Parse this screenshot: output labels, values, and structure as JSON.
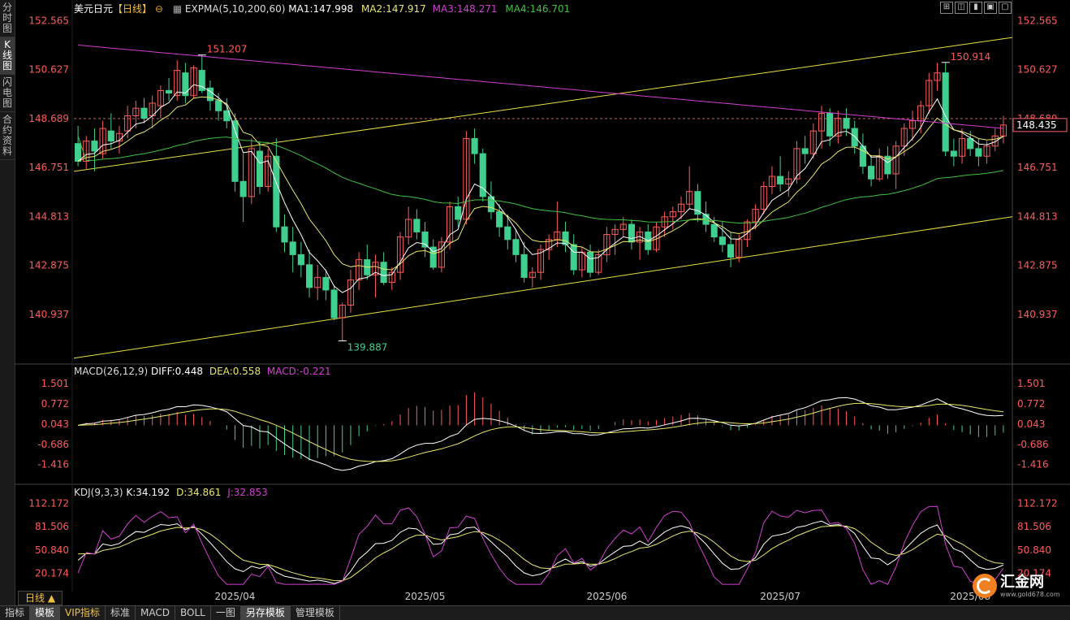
{
  "sidebar": {
    "tabs": [
      {
        "label": "分时图",
        "active": false
      },
      {
        "label": "K线图",
        "active": true
      },
      {
        "label": "闪电图",
        "active": false
      },
      {
        "label": "合约资料",
        "active": false
      }
    ]
  },
  "header": {
    "symbol": "美元日元",
    "period": "【日线】",
    "expma_label": "EXPMA(5,10,200,60)",
    "ma1": "MA1:147.998",
    "ma2": "MA2:147.917",
    "ma3": "MA3:148.271",
    "ma4": "MA4:146.701"
  },
  "window_buttons": [
    "⊞",
    "◫",
    "▮",
    "▣",
    "▢"
  ],
  "price_axis": {
    "ticks": [
      "152.565",
      "150.627",
      "148.689",
      "146.751",
      "144.813",
      "142.875",
      "140.937"
    ],
    "current_price": "148.435",
    "ref_price": "148.689"
  },
  "annotations": {
    "high1": "151.207",
    "low1": "139.887",
    "high2": "150.914"
  },
  "macd": {
    "label": "MACD(26,12,9)",
    "diff": "DIFF:0.448",
    "dea": "DEA:0.558",
    "macd": "MACD:-0.221",
    "ticks": [
      "1.501",
      "0.772",
      "0.043",
      "-0.686",
      "-1.416"
    ]
  },
  "kdj": {
    "label": "KDJ(9,3,3)",
    "k": "K:34.192",
    "d": "D:34.861",
    "j": "J:32.853",
    "ticks": [
      "112.172",
      "81.506",
      "50.840",
      "20.174"
    ]
  },
  "time_axis": [
    "2025/04",
    "2025/05",
    "2025/06",
    "2025/07",
    "2025/08"
  ],
  "period_button": "日线 ▲",
  "bottom_tabs": [
    {
      "label": "指标",
      "active": false,
      "vip": false
    },
    {
      "label": "模板",
      "active": true,
      "vip": false
    },
    {
      "label": "VIP指标",
      "active": false,
      "vip": true
    },
    {
      "label": "标准",
      "active": false,
      "vip": false
    },
    {
      "label": "MACD",
      "active": false,
      "vip": false
    },
    {
      "label": "BOLL",
      "active": false,
      "vip": false
    },
    {
      "label": "一图",
      "active": false,
      "vip": false
    },
    {
      "label": "另存模板",
      "active": true,
      "vip": false
    },
    {
      "label": "管理模板",
      "active": false,
      "vip": false
    }
  ],
  "logo": {
    "name": "汇金网",
    "url": "www.gold678.com"
  },
  "colors": {
    "up": "#ff5a5a",
    "down": "#3fcf8e",
    "ma1": "#ffffff",
    "ma2": "#e8e86a",
    "ma3": "#d040d0",
    "ma4": "#40c040",
    "channel": "#e8e040",
    "axis_text": "#ff5a5a"
  },
  "chart_data": {
    "type": "candlestick",
    "instrument": "USD/JPY",
    "period": "daily",
    "y_range": [
      139.0,
      153.0
    ],
    "points": [
      {
        "o": 147.7,
        "h": 148.4,
        "l": 146.8,
        "c": 147.0
      },
      {
        "o": 147.0,
        "h": 148.0,
        "l": 146.7,
        "c": 147.8
      },
      {
        "o": 147.8,
        "h": 148.3,
        "l": 146.6,
        "c": 147.4
      },
      {
        "o": 147.3,
        "h": 148.6,
        "l": 147.1,
        "c": 148.3
      },
      {
        "o": 148.2,
        "h": 148.9,
        "l": 147.5,
        "c": 147.8
      },
      {
        "o": 147.8,
        "h": 148.4,
        "l": 147.3,
        "c": 148.1
      },
      {
        "o": 148.2,
        "h": 149.2,
        "l": 147.9,
        "c": 148.8
      },
      {
        "o": 148.8,
        "h": 149.4,
        "l": 148.3,
        "c": 149.1
      },
      {
        "o": 149.1,
        "h": 149.5,
        "l": 148.5,
        "c": 148.7
      },
      {
        "o": 148.8,
        "h": 149.6,
        "l": 148.3,
        "c": 149.3
      },
      {
        "o": 149.2,
        "h": 150.0,
        "l": 148.7,
        "c": 149.8
      },
      {
        "o": 149.8,
        "h": 150.3,
        "l": 149.4,
        "c": 149.7
      },
      {
        "o": 149.6,
        "h": 151.0,
        "l": 149.4,
        "c": 150.6
      },
      {
        "o": 150.5,
        "h": 150.9,
        "l": 149.3,
        "c": 149.6
      },
      {
        "o": 149.6,
        "h": 150.8,
        "l": 149.5,
        "c": 150.7
      },
      {
        "o": 150.6,
        "h": 151.2,
        "l": 149.7,
        "c": 149.8
      },
      {
        "o": 149.9,
        "h": 150.2,
        "l": 149.0,
        "c": 149.4
      },
      {
        "o": 149.4,
        "h": 149.7,
        "l": 148.6,
        "c": 149.0
      },
      {
        "o": 149.0,
        "h": 149.5,
        "l": 148.3,
        "c": 148.6
      },
      {
        "o": 148.6,
        "h": 148.9,
        "l": 145.8,
        "c": 146.2
      },
      {
        "o": 146.2,
        "h": 147.3,
        "l": 144.6,
        "c": 145.6
      },
      {
        "o": 145.6,
        "h": 147.9,
        "l": 145.3,
        "c": 147.5
      },
      {
        "o": 147.4,
        "h": 147.8,
        "l": 145.7,
        "c": 146.0
      },
      {
        "o": 146.0,
        "h": 147.5,
        "l": 145.8,
        "c": 147.2
      },
      {
        "o": 147.2,
        "h": 147.9,
        "l": 144.2,
        "c": 144.4
      },
      {
        "o": 144.4,
        "h": 144.9,
        "l": 143.4,
        "c": 143.8
      },
      {
        "o": 143.8,
        "h": 144.4,
        "l": 142.6,
        "c": 143.3
      },
      {
        "o": 143.3,
        "h": 143.8,
        "l": 142.4,
        "c": 142.9
      },
      {
        "o": 142.9,
        "h": 143.5,
        "l": 141.6,
        "c": 142.0
      },
      {
        "o": 142.0,
        "h": 142.9,
        "l": 141.5,
        "c": 142.4
      },
      {
        "o": 142.4,
        "h": 142.7,
        "l": 141.5,
        "c": 141.9
      },
      {
        "o": 141.9,
        "h": 142.1,
        "l": 140.7,
        "c": 140.8
      },
      {
        "o": 140.8,
        "h": 141.4,
        "l": 139.9,
        "c": 141.3
      },
      {
        "o": 141.3,
        "h": 142.7,
        "l": 141.0,
        "c": 142.3
      },
      {
        "o": 142.3,
        "h": 143.4,
        "l": 141.9,
        "c": 143.1
      },
      {
        "o": 143.1,
        "h": 143.7,
        "l": 142.3,
        "c": 142.5
      },
      {
        "o": 142.5,
        "h": 143.3,
        "l": 141.6,
        "c": 143.0
      },
      {
        "o": 143.0,
        "h": 143.4,
        "l": 142.1,
        "c": 142.2
      },
      {
        "o": 142.2,
        "h": 142.8,
        "l": 141.9,
        "c": 142.6
      },
      {
        "o": 142.6,
        "h": 144.2,
        "l": 142.3,
        "c": 144.0
      },
      {
        "o": 144.0,
        "h": 145.2,
        "l": 143.7,
        "c": 144.7
      },
      {
        "o": 144.7,
        "h": 145.1,
        "l": 143.9,
        "c": 144.2
      },
      {
        "o": 144.2,
        "h": 144.6,
        "l": 143.2,
        "c": 143.6
      },
      {
        "o": 143.6,
        "h": 143.9,
        "l": 142.7,
        "c": 142.8
      },
      {
        "o": 142.8,
        "h": 144.0,
        "l": 142.6,
        "c": 143.8
      },
      {
        "o": 143.8,
        "h": 145.4,
        "l": 143.5,
        "c": 145.2
      },
      {
        "o": 145.2,
        "h": 145.6,
        "l": 144.4,
        "c": 144.7
      },
      {
        "o": 144.7,
        "h": 148.2,
        "l": 144.5,
        "c": 147.9
      },
      {
        "o": 147.9,
        "h": 148.3,
        "l": 146.9,
        "c": 147.3
      },
      {
        "o": 147.3,
        "h": 147.5,
        "l": 145.4,
        "c": 145.6
      },
      {
        "o": 145.6,
        "h": 146.2,
        "l": 144.7,
        "c": 145.0
      },
      {
        "o": 145.0,
        "h": 145.3,
        "l": 144.0,
        "c": 144.4
      },
      {
        "o": 144.4,
        "h": 144.9,
        "l": 143.5,
        "c": 143.9
      },
      {
        "o": 143.9,
        "h": 144.3,
        "l": 143.0,
        "c": 143.3
      },
      {
        "o": 143.3,
        "h": 143.8,
        "l": 142.2,
        "c": 142.4
      },
      {
        "o": 142.4,
        "h": 142.8,
        "l": 142.0,
        "c": 142.6
      },
      {
        "o": 142.6,
        "h": 143.7,
        "l": 142.3,
        "c": 143.5
      },
      {
        "o": 143.5,
        "h": 144.1,
        "l": 143.1,
        "c": 143.9
      },
      {
        "o": 143.9,
        "h": 145.4,
        "l": 143.6,
        "c": 144.2
      },
      {
        "o": 144.2,
        "h": 144.6,
        "l": 143.4,
        "c": 143.7
      },
      {
        "o": 143.7,
        "h": 144.1,
        "l": 142.5,
        "c": 142.7
      },
      {
        "o": 142.7,
        "h": 143.6,
        "l": 142.4,
        "c": 143.4
      },
      {
        "o": 143.4,
        "h": 143.7,
        "l": 142.4,
        "c": 142.6
      },
      {
        "o": 142.6,
        "h": 143.5,
        "l": 142.5,
        "c": 143.3
      },
      {
        "o": 143.3,
        "h": 144.4,
        "l": 143.0,
        "c": 144.1
      },
      {
        "o": 144.1,
        "h": 144.5,
        "l": 143.3,
        "c": 144.3
      },
      {
        "o": 144.3,
        "h": 144.8,
        "l": 144.0,
        "c": 144.5
      },
      {
        "o": 144.5,
        "h": 144.7,
        "l": 143.5,
        "c": 143.8
      },
      {
        "o": 143.8,
        "h": 144.4,
        "l": 143.1,
        "c": 144.2
      },
      {
        "o": 144.2,
        "h": 144.5,
        "l": 143.3,
        "c": 143.5
      },
      {
        "o": 143.5,
        "h": 144.6,
        "l": 143.4,
        "c": 144.4
      },
      {
        "o": 144.4,
        "h": 145.0,
        "l": 144.0,
        "c": 144.8
      },
      {
        "o": 144.8,
        "h": 145.2,
        "l": 144.3,
        "c": 145.0
      },
      {
        "o": 145.0,
        "h": 145.6,
        "l": 144.7,
        "c": 145.3
      },
      {
        "o": 145.3,
        "h": 146.8,
        "l": 145.1,
        "c": 145.8
      },
      {
        "o": 145.8,
        "h": 146.1,
        "l": 144.6,
        "c": 144.9
      },
      {
        "o": 144.9,
        "h": 145.4,
        "l": 144.2,
        "c": 144.5
      },
      {
        "o": 144.5,
        "h": 144.8,
        "l": 143.8,
        "c": 144.0
      },
      {
        "o": 144.0,
        "h": 144.6,
        "l": 143.4,
        "c": 143.7
      },
      {
        "o": 143.7,
        "h": 144.2,
        "l": 142.8,
        "c": 143.2
      },
      {
        "o": 143.2,
        "h": 144.1,
        "l": 143.0,
        "c": 143.9
      },
      {
        "o": 143.9,
        "h": 144.7,
        "l": 143.6,
        "c": 144.6
      },
      {
        "o": 144.6,
        "h": 145.3,
        "l": 144.3,
        "c": 145.1
      },
      {
        "o": 145.1,
        "h": 146.2,
        "l": 144.9,
        "c": 146.0
      },
      {
        "o": 146.0,
        "h": 146.8,
        "l": 145.7,
        "c": 146.4
      },
      {
        "o": 146.4,
        "h": 147.2,
        "l": 145.8,
        "c": 146.1
      },
      {
        "o": 146.1,
        "h": 146.6,
        "l": 145.6,
        "c": 146.3
      },
      {
        "o": 146.3,
        "h": 147.8,
        "l": 146.1,
        "c": 147.5
      },
      {
        "o": 147.5,
        "h": 148.0,
        "l": 146.9,
        "c": 147.3
      },
      {
        "o": 147.3,
        "h": 148.5,
        "l": 147.1,
        "c": 148.2
      },
      {
        "o": 148.2,
        "h": 149.2,
        "l": 147.5,
        "c": 148.9
      },
      {
        "o": 148.9,
        "h": 149.1,
        "l": 147.6,
        "c": 148.0
      },
      {
        "o": 148.0,
        "h": 149.0,
        "l": 147.7,
        "c": 148.7
      },
      {
        "o": 148.7,
        "h": 149.1,
        "l": 148.0,
        "c": 148.3
      },
      {
        "o": 148.3,
        "h": 148.6,
        "l": 147.3,
        "c": 147.6
      },
      {
        "o": 147.6,
        "h": 148.1,
        "l": 146.5,
        "c": 146.8
      },
      {
        "o": 146.8,
        "h": 147.2,
        "l": 146.0,
        "c": 146.3
      },
      {
        "o": 146.3,
        "h": 147.5,
        "l": 146.2,
        "c": 147.2
      },
      {
        "o": 147.2,
        "h": 147.6,
        "l": 146.3,
        "c": 146.5
      },
      {
        "o": 146.5,
        "h": 147.8,
        "l": 145.9,
        "c": 147.6
      },
      {
        "o": 147.6,
        "h": 148.5,
        "l": 147.2,
        "c": 148.3
      },
      {
        "o": 148.3,
        "h": 149.0,
        "l": 147.8,
        "c": 148.6
      },
      {
        "o": 148.6,
        "h": 149.4,
        "l": 148.1,
        "c": 149.2
      },
      {
        "o": 149.2,
        "h": 150.5,
        "l": 148.9,
        "c": 150.2
      },
      {
        "o": 150.2,
        "h": 150.9,
        "l": 149.8,
        "c": 150.5
      },
      {
        "o": 150.5,
        "h": 150.9,
        "l": 147.2,
        "c": 147.4
      },
      {
        "o": 147.4,
        "h": 147.9,
        "l": 146.8,
        "c": 147.2
      },
      {
        "o": 147.2,
        "h": 148.3,
        "l": 146.9,
        "c": 147.9
      },
      {
        "o": 147.9,
        "h": 148.2,
        "l": 147.2,
        "c": 147.5
      },
      {
        "o": 147.5,
        "h": 147.9,
        "l": 146.8,
        "c": 147.2
      },
      {
        "o": 147.2,
        "h": 147.8,
        "l": 146.9,
        "c": 147.6
      },
      {
        "o": 147.6,
        "h": 148.3,
        "l": 147.4,
        "c": 148.0
      },
      {
        "o": 148.0,
        "h": 148.8,
        "l": 147.7,
        "c": 148.435
      }
    ]
  }
}
